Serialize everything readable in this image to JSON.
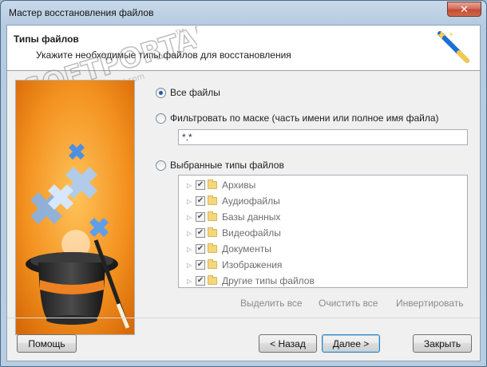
{
  "window": {
    "title": "Мастер восстановления файлов",
    "close_label": "✕"
  },
  "header": {
    "title": "Типы файлов",
    "subtitle": "Укажите необходимые типы файлов для восстановления"
  },
  "watermark": {
    "text": "SOFTPORTAL",
    "url": "www.softportal.com",
    "tm": "TM"
  },
  "options": {
    "all_files": "Все файлы",
    "filter_mask": "Фильтровать по маске (часть имени или полное имя файла)",
    "mask_value": "*.*",
    "selected_types": "Выбранные типы файлов"
  },
  "file_types": [
    {
      "label": "Архивы",
      "checked": true
    },
    {
      "label": "Аудиофайлы",
      "checked": true
    },
    {
      "label": "Базы данных",
      "checked": true
    },
    {
      "label": "Видеофайлы",
      "checked": true
    },
    {
      "label": "Документы",
      "checked": true
    },
    {
      "label": "Изображения",
      "checked": true
    },
    {
      "label": "Другие типы файлов",
      "checked": true
    }
  ],
  "actions": {
    "select_all": "Выделить все",
    "clear_all": "Очистить все",
    "invert": "Инвертировать"
  },
  "buttons": {
    "help": "Помощь",
    "back": "< Назад",
    "next": "Далее >",
    "close": "Закрыть"
  },
  "selected_option": "all_files",
  "check_glyph": "✔",
  "expander_glyph": "▷",
  "colors": {
    "accent": "#3c7fb1",
    "image_bg": "#f08a1c",
    "disabled_text": "#8a8a8a"
  }
}
